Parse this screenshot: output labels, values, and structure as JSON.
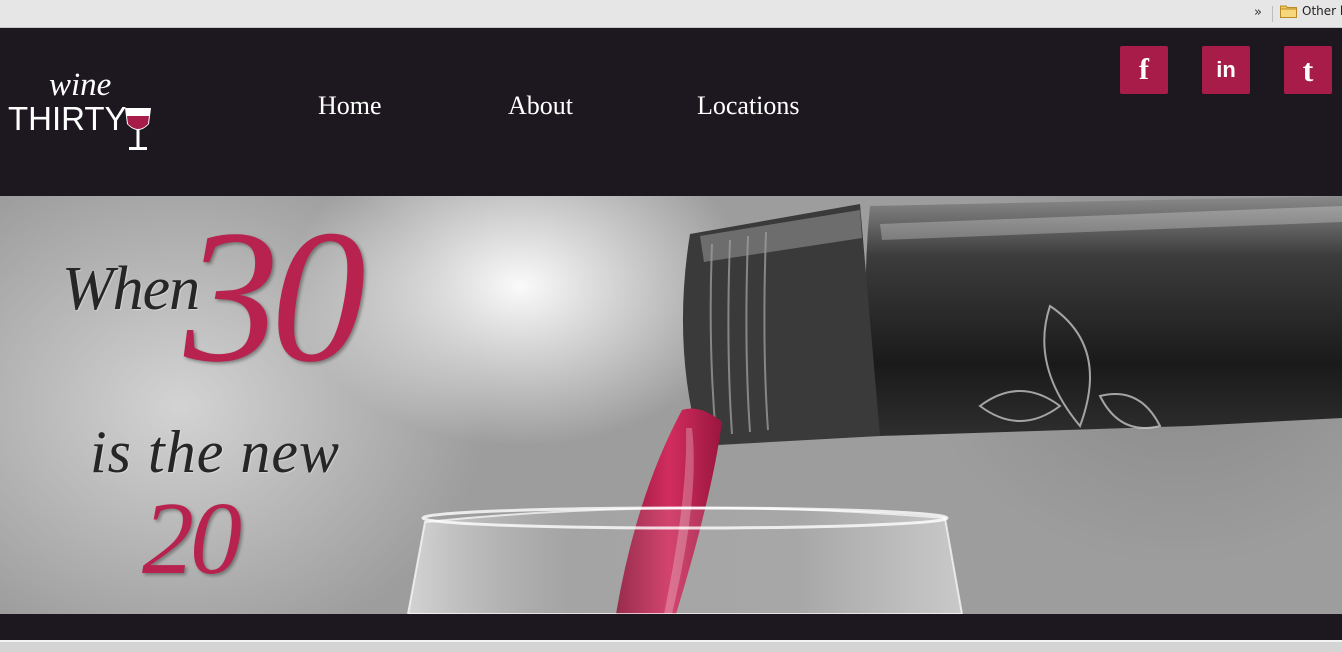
{
  "browser": {
    "overflow_chevron": "»",
    "other_bookmarks_label": "Other b"
  },
  "logo": {
    "line1": "wine",
    "line2": "THIRTY"
  },
  "nav": {
    "items": [
      {
        "label": "Home"
      },
      {
        "label": "About"
      },
      {
        "label": "Locations"
      }
    ]
  },
  "social": [
    {
      "icon": "facebook-icon",
      "glyph": "f"
    },
    {
      "icon": "linkedin-icon",
      "glyph": "in"
    },
    {
      "icon": "twitter-icon",
      "glyph": "t"
    }
  ],
  "hero": {
    "line_when": "When",
    "line_30": "30",
    "line_new": "is the new",
    "line_20": "20"
  },
  "colors": {
    "header_bg": "#1d1820",
    "accent": "#a71c48",
    "wine": "#b8224e"
  }
}
